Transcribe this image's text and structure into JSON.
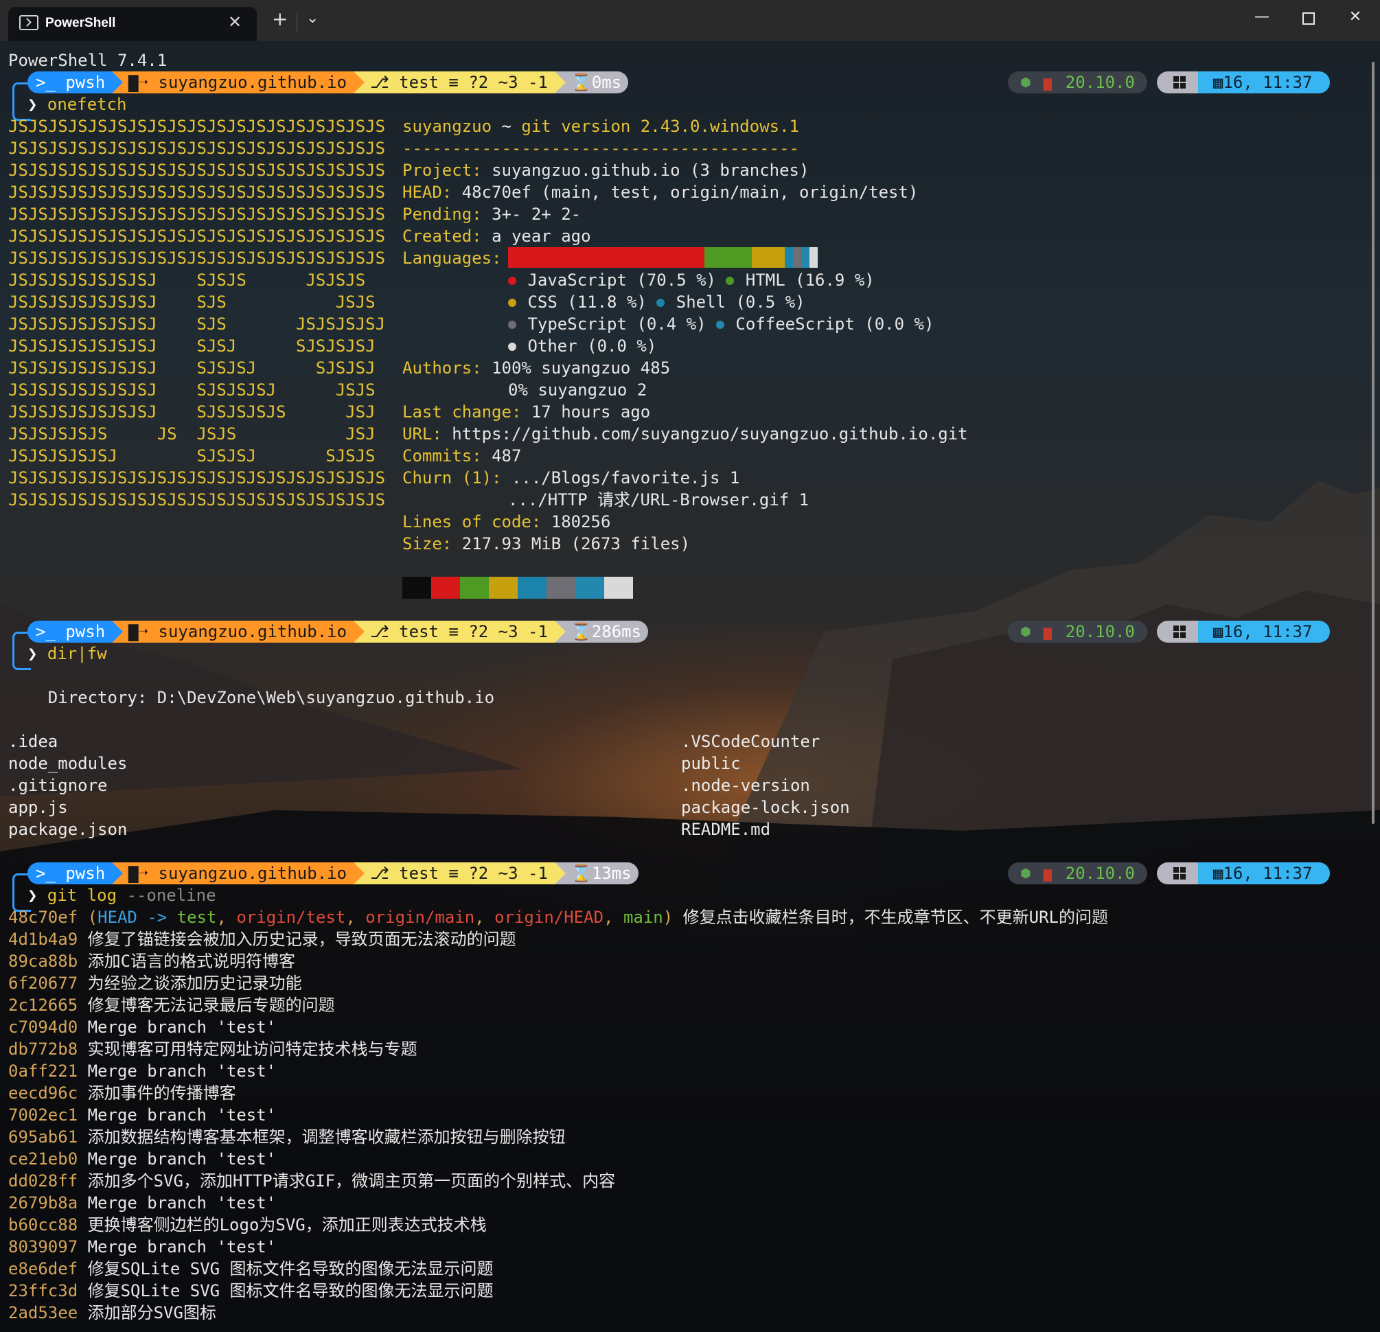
{
  "window": {
    "tab_title": "PowerShell",
    "new_tab_glyph": "+",
    "dropdown_glyph": "⌄",
    "close_tab_glyph": "✕",
    "minimize_glyph": "—",
    "close_glyph": "✕"
  },
  "header_line": "PowerShell 7.4.1",
  "prompts": [
    {
      "shell": ">_ pwsh",
      "dir": "suyangzuo.github.io",
      "branch": "test",
      "git_status": "≡ ?2 ~3 -1",
      "duration": "0ms",
      "node": "20.10.0",
      "date": "16, 11:37",
      "command": "onefetch"
    },
    {
      "shell": ">_ pwsh",
      "dir": "suyangzuo.github.io",
      "branch": "test",
      "git_status": "≡ ?2 ~3 -1",
      "duration": "286ms",
      "node": "20.10.0",
      "date": "16, 11:37",
      "command": "dir|fw"
    },
    {
      "shell": ">_ pwsh",
      "dir": "suyangzuo.github.io",
      "branch": "test",
      "git_status": "≡ ?2 ~3 -1",
      "duration": "13ms",
      "node": "20.10.0",
      "date": "16, 11:37",
      "command": "git log",
      "command_suffix": " --oneline"
    }
  ],
  "onefetch": {
    "ascii_art": [
      "JSJSJSJSJSJSJSJSJSJSJSJSJSJSJSJSJSJSJS",
      "JSJSJSJSJSJSJSJSJSJSJSJSJSJSJSJSJSJSJS",
      "JSJSJSJSJSJSJSJSJSJSJSJSJSJSJSJSJSJSJS",
      "JSJSJSJSJSJSJSJSJSJSJSJSJSJSJSJSJSJSJS",
      "JSJSJSJSJSJSJSJSJSJSJSJSJSJSJSJSJSJSJS",
      "JSJSJSJSJSJSJSJSJSJSJSJSJSJSJSJSJSJSJS",
      "JSJSJSJSJSJSJSJSJSJSJSJSJSJSJSJSJSJSJS",
      "JSJSJSJSJSJSJSJ    SJSJS      JSJSJS",
      "JSJSJSJSJSJSJSJ    SJS           JSJS",
      "JSJSJSJSJSJSJSJ    SJS       JSJSJSJSJ",
      "JSJSJSJSJSJSJSJ    SJSJ      SJSJSJSJ",
      "JSJSJSJSJSJSJSJ    SJSJSJ      SJSJSJ",
      "JSJSJSJSJSJSJSJ    SJSJSJSJ      JSJS",
      "JSJSJSJSJSJSJSJ    SJSJSJSJS      JSJ",
      "JSJSJSJSJS     JS  JSJS           JSJ",
      "JSJSJSJSJSJ        SJSJSJ       SJSJS",
      "JSJSJSJSJSJSJSJSJSJSJSJSJSJSJSJSJSJSJS",
      "JSJSJSJSJSJSJSJSJSJSJSJSJSJSJSJSJSJSJS"
    ],
    "title_user": "suyangzuo",
    "title_sep": " ~ ",
    "title_version": "git version 2.43.0.windows.1",
    "separator": "----------------------------------------",
    "project_label": "Project",
    "project_value": "suyangzuo.github.io (3 branches)",
    "head_label": "HEAD",
    "head_value": "48c70ef (main, test, origin/main, origin/test)",
    "pending_label": "Pending",
    "pending_value": "3+- 2+ 2-",
    "created_label": "Created",
    "created_value": "a year ago",
    "languages_label": "Languages",
    "languages": [
      {
        "name": "JavaScript",
        "pct_text": "(70.5 %)",
        "pct": 70.5,
        "color": "#d7191c"
      },
      {
        "name": "HTML",
        "pct_text": "(16.9 %)",
        "pct": 16.9,
        "color": "#4e9a23"
      },
      {
        "name": "CSS",
        "pct_text": "(11.8 %)",
        "pct": 11.8,
        "color": "#c6a00f"
      },
      {
        "name": "Shell",
        "pct_text": "(0.5 %)",
        "pct": 0.5,
        "color": "#1c84aa"
      },
      {
        "name": "TypeScript",
        "pct_text": "(0.4 %)",
        "pct": 0.4,
        "color": "#6e6e74"
      },
      {
        "name": "CoffeeScript",
        "pct_text": "(0.0 %)",
        "pct": 0.0,
        "color": "#2487ad"
      },
      {
        "name": "Other",
        "pct_text": "(0.0 %)",
        "pct": 0.0,
        "color": "#d9d9d9"
      }
    ],
    "authors_label": "Authors",
    "authors": [
      "100% suyangzuo 485",
      "0% suyangzuo 2"
    ],
    "last_change_label": "Last change",
    "last_change_value": "17 hours ago",
    "url_label": "URL",
    "url_value": "https://github.com/suyangzuo/suyangzuo.github.io.git",
    "commits_label": "Commits",
    "commits_value": "487",
    "churn_label": "Churn (1)",
    "churn": [
      ".../Blogs/favorite.js 1",
      ".../HTTP 请求/URL-Browser.gif 1"
    ],
    "loc_label": "Lines of code",
    "loc_value": "180256",
    "size_label": "Size",
    "size_value": "217.93 MiB (2673 files)",
    "palette": [
      "#0c0c0c",
      "#d7191c",
      "#4e9a23",
      "#c6a00f",
      "#1c84aa",
      "#6e6e74",
      "#2487ad",
      "#d9d9d9"
    ]
  },
  "dir_listing": {
    "directory_line": "    Directory: D:\\DevZone\\Web\\suyangzuo.github.io",
    "left": [
      ".idea",
      "node_modules",
      ".gitignore",
      "app.js",
      "package.json"
    ],
    "right": [
      ".VSCodeCounter",
      "public",
      ".node-version",
      "package-lock.json",
      "README.md"
    ]
  },
  "git_log": {
    "first": {
      "hash": "48c70ef",
      "open": " (",
      "head": "HEAD",
      "arrow": " -> ",
      "test": "test",
      "c1": ", ",
      "ot": "origin/test",
      "c2": ", ",
      "om": "origin/main",
      "c3": ", ",
      "oh": "origin/HEAD",
      "c4": ", ",
      "main": "main",
      "close": ")",
      "msg": " 修复点击收藏栏条目时，不生成章节区、不更新URL的问题"
    },
    "entries": [
      {
        "hash": "4d1b4a9",
        "msg": "修复了锚链接会被加入历史记录，导致页面无法滚动的问题"
      },
      {
        "hash": "89ca88b",
        "msg": "添加C语言的格式说明符博客"
      },
      {
        "hash": "6f20677",
        "msg": "为经验之谈添加历史记录功能"
      },
      {
        "hash": "2c12665",
        "msg": "修复博客无法记录最后专题的问题"
      },
      {
        "hash": "c7094d0",
        "msg": "Merge branch 'test'"
      },
      {
        "hash": "db772b8",
        "msg": "实现博客可用特定网址访问特定技术栈与专题"
      },
      {
        "hash": "0aff221",
        "msg": "Merge branch 'test'"
      },
      {
        "hash": "eecd96c",
        "msg": "添加事件的传播博客"
      },
      {
        "hash": "7002ec1",
        "msg": "Merge branch 'test'"
      },
      {
        "hash": "695ab61",
        "msg": "添加数据结构博客基本框架，调整博客收藏栏添加按钮与删除按钮"
      },
      {
        "hash": "ce21eb0",
        "msg": "Merge branch 'test'"
      },
      {
        "hash": "dd028ff",
        "msg": "添加多个SVG，添加HTTP请求GIF，微调主页第一页面的个别样式、内容"
      },
      {
        "hash": "2679b8a",
        "msg": "Merge branch 'test'"
      },
      {
        "hash": "b60cc88",
        "msg": "更换博客侧边栏的Logo为SVG，添加正则表达式技术栈"
      },
      {
        "hash": "8039097",
        "msg": "Merge branch 'test'"
      },
      {
        "hash": "e8e6def",
        "msg": "修复SQLite SVG 图标文件名导致的图像无法显示问题"
      },
      {
        "hash": "23ffc3d",
        "msg": "修复SQLite SVG 图标文件名导致的图像无法显示问题"
      },
      {
        "hash": "2ad53ee",
        "msg": "添加部分SVG图标"
      }
    ]
  }
}
